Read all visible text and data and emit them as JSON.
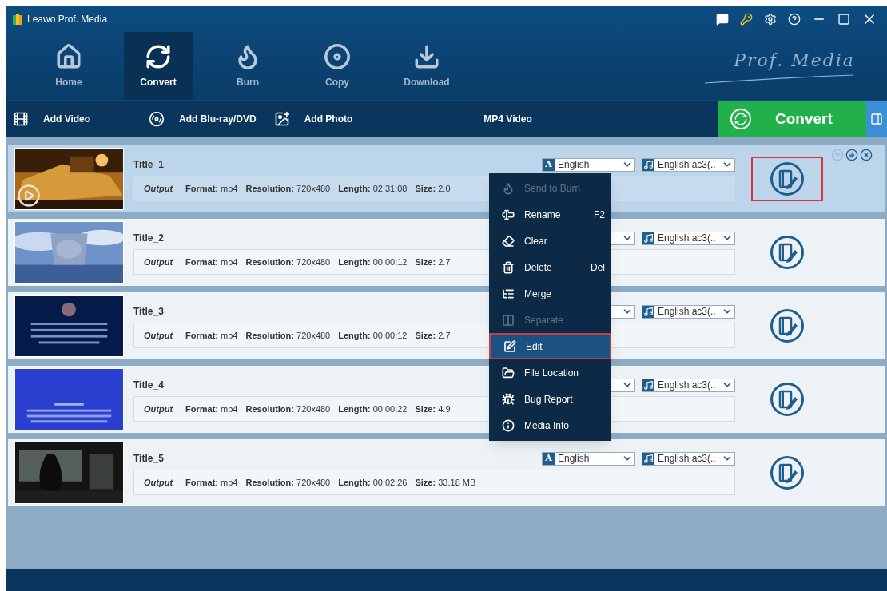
{
  "window": {
    "title": "Leawo Prof. Media"
  },
  "nav_tabs": [
    {
      "label": "Home",
      "selected": false
    },
    {
      "label": "Convert",
      "selected": true
    },
    {
      "label": "Burn",
      "selected": false
    },
    {
      "label": "Copy",
      "selected": false
    },
    {
      "label": "Download",
      "selected": false
    }
  ],
  "logo_text": "Prof. Media",
  "toolbar": {
    "items": [
      "Add Video",
      "Add Blu-ray/DVD",
      "Add Photo"
    ],
    "profile": "MP4 Video",
    "convert_button": "Convert"
  },
  "videos": [
    {
      "title": "Title_1",
      "selected": true,
      "edit_highlighted": true,
      "output_label": "Output",
      "format_label": "Format:",
      "format": "mp4",
      "resolution_label": "Resolution:",
      "resolution": "720x480",
      "length_label": "Length:",
      "length": "02:31:08",
      "size_label": "Size:",
      "size": "2.0",
      "audio_badge": "A",
      "audio": "English",
      "subtitle": "English ac3(.."
    },
    {
      "title": "Title_2",
      "selected": false,
      "edit_highlighted": false,
      "output_label": "Output",
      "format_label": "Format:",
      "format": "mp4",
      "resolution_label": "Resolution:",
      "resolution": "720x480",
      "length_label": "Length:",
      "length": "00:00:12",
      "size_label": "Size:",
      "size": "2.7",
      "subtitle": "English ac3(.."
    },
    {
      "title": "Title_3",
      "selected": false,
      "edit_highlighted": false,
      "output_label": "Output",
      "format_label": "Format:",
      "format": "mp4",
      "resolution_label": "Resolution:",
      "resolution": "720x480",
      "length_label": "Length:",
      "length": "00:00:12",
      "size_label": "Size:",
      "size": "2.7",
      "subtitle": "English ac3(.."
    },
    {
      "title": "Title_4",
      "selected": false,
      "edit_highlighted": false,
      "output_label": "Output",
      "format_label": "Format:",
      "format": "mp4",
      "resolution_label": "Resolution:",
      "resolution": "720x480",
      "length_label": "Length:",
      "length": "00:00:22",
      "size_label": "Size:",
      "size": "4.9",
      "subtitle": "English ac3(.."
    },
    {
      "title": "Title_5",
      "selected": false,
      "edit_highlighted": false,
      "output_label": "Output",
      "format_label": "Format:",
      "format": "mp4",
      "resolution_label": "Resolution:",
      "resolution": "720x480",
      "length_label": "Length:",
      "length": "00:02:26",
      "size_label": "Size:",
      "size": "33.18 MB",
      "audio_badge": "A",
      "audio": "English",
      "subtitle": "English ac3(.."
    }
  ],
  "context_menu": [
    {
      "label": "Send to Burn",
      "disabled": true,
      "selected": false
    },
    {
      "label": "Rename",
      "shortcut": "F2",
      "disabled": false,
      "selected": false
    },
    {
      "label": "Clear",
      "disabled": false,
      "selected": false
    },
    {
      "label": "Delete",
      "shortcut": "Del",
      "disabled": false,
      "selected": false
    },
    {
      "label": "Merge",
      "disabled": false,
      "selected": false
    },
    {
      "label": "Separate",
      "disabled": true,
      "selected": false
    },
    {
      "label": "Edit",
      "disabled": false,
      "selected": true
    },
    {
      "label": "File Location",
      "disabled": false,
      "selected": false
    },
    {
      "label": "Bug Report",
      "disabled": false,
      "selected": false
    },
    {
      "label": "Media Info",
      "disabled": false,
      "selected": false
    }
  ]
}
